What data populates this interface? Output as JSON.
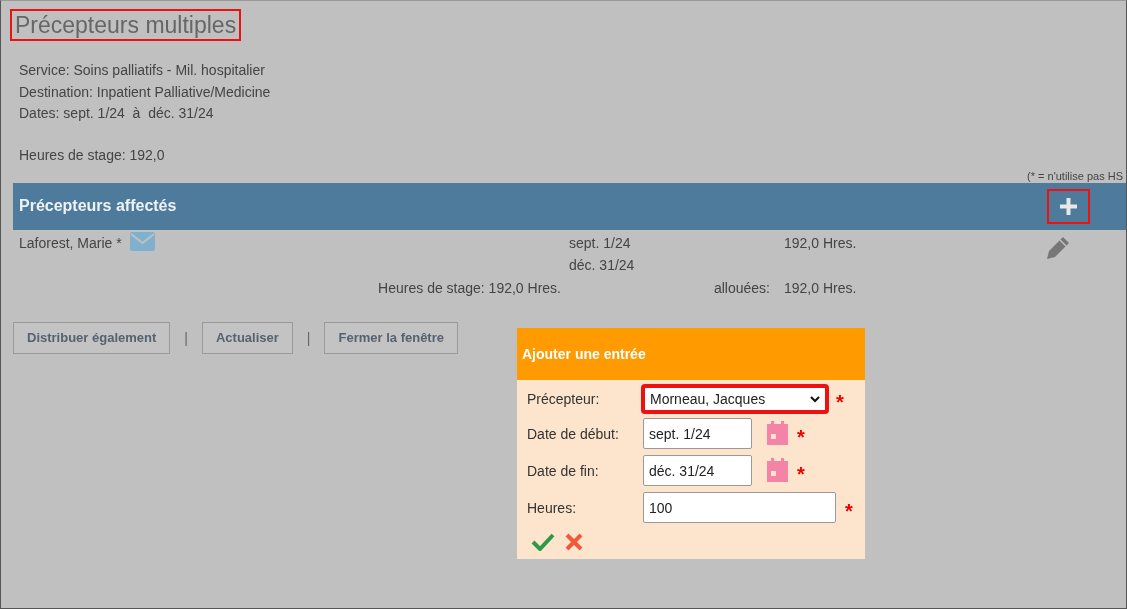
{
  "title": {
    "text": "Précepteurs multiples",
    "highlighted": true
  },
  "info_lines": [
    "Service: Soins palliatifs - Mil. hospitalier",
    "Destination: Inpatient Palliative/Medicine",
    "Dates: sept. 1/24  à  déc. 31/24"
  ],
  "hours_line": "Heures de stage: 192,0",
  "note": "(* = n'utilise pas HS",
  "section": {
    "title": "Précepteurs affectés",
    "add_highlighted": true
  },
  "preceptors": [
    {
      "name": "Laforest, Marie *",
      "start": "sept. 1/24",
      "end": "déc. 31/24",
      "hours": "192,0 Hres."
    }
  ],
  "totals": {
    "stage": "Heures de stage: 192,0 Hres.",
    "allocated_label": "allouées:",
    "allocated": "192,0 Hres."
  },
  "toolbar": [
    {
      "kind": "button",
      "label": "Distribuer également"
    },
    {
      "kind": "separator",
      "label": "|"
    },
    {
      "kind": "button",
      "label": "Actualiser"
    },
    {
      "kind": "separator",
      "label": "|"
    },
    {
      "kind": "button",
      "label": "Fermer la fenêtre"
    }
  ],
  "dialog": {
    "title": "Ajouter une entrée",
    "fields": [
      {
        "kind": "select",
        "label": "Précepteur:",
        "value": "Morneau, Jacques",
        "required_mark": "*",
        "highlighted": true
      },
      {
        "kind": "date",
        "label": "Date de début:",
        "value": "sept. 1/24",
        "required_mark": "*",
        "highlighted": false
      },
      {
        "kind": "date",
        "label": "Date de fin:",
        "value": "déc. 31/24",
        "required_mark": "*",
        "highlighted": false
      },
      {
        "kind": "text",
        "label": "Heures:",
        "value": "100",
        "required_mark": "*",
        "highlighted": false
      }
    ]
  }
}
